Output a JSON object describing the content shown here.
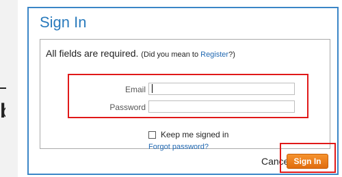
{
  "background": {
    "dash": "-",
    "char": "b"
  },
  "dialog": {
    "title": "Sign In",
    "required_text": "All fields are required.",
    "hint_prefix": "(Did you mean to ",
    "register_link": "Register",
    "hint_suffix": "?)",
    "email_label": "Email",
    "email_value": "",
    "password_label": "Password",
    "password_value": "",
    "keep_signed_in_label": "Keep me signed in",
    "keep_signed_in_checked": false,
    "forgot_link": "Forgot password?",
    "cancel_label": "Cancel",
    "signin_button_label": "Sign In"
  },
  "colors": {
    "accent": "#2a7bbd",
    "button": "#f07f1b",
    "highlight_box": "#e01818",
    "link": "#1f67b1"
  }
}
